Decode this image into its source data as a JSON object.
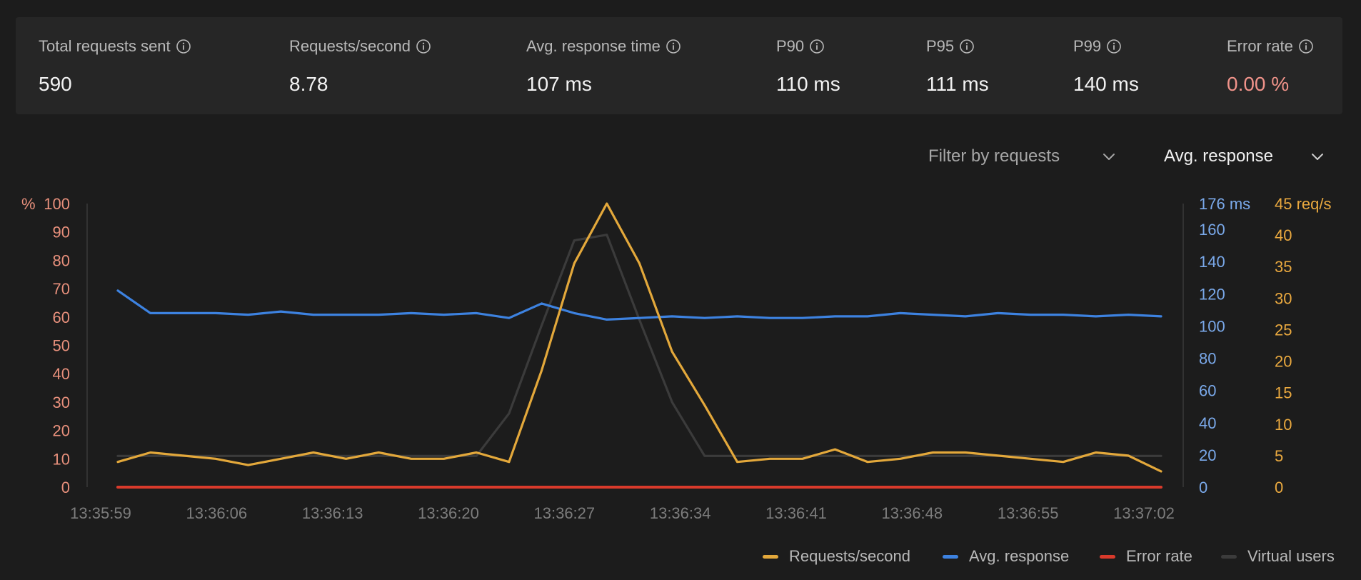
{
  "stats": [
    {
      "label": "Total requests sent",
      "value": "590"
    },
    {
      "label": "Requests/second",
      "value": "8.78"
    },
    {
      "label": "Avg. response time",
      "value": "107 ms"
    },
    {
      "label": "P90",
      "value": "110 ms"
    },
    {
      "label": "P95",
      "value": "111 ms"
    },
    {
      "label": "P99",
      "value": "140 ms"
    },
    {
      "label": "Error rate",
      "value": "0.00 %"
    }
  ],
  "controls": {
    "filter_label": "Filter by requests",
    "metric_label": "Avg. response"
  },
  "colors": {
    "requests": "#e3a83b",
    "avg_response": "#3d82e0",
    "error_rate": "#d93a2b",
    "virtual_users": "#3b3b3b",
    "left_axis": "#e8907c",
    "mid_axis": "#7aa9ea",
    "right_axis": "#eaa93f",
    "error_value": "#f0938a"
  },
  "chart_data": {
    "type": "line",
    "x": [
      "13:35:59",
      "13:36:01",
      "13:36:02",
      "13:36:04",
      "13:36:06",
      "13:36:08",
      "13:36:10",
      "13:36:12",
      "13:36:13",
      "13:36:15",
      "13:36:17",
      "13:36:19",
      "13:36:21",
      "13:36:22",
      "13:36:24",
      "13:36:26",
      "13:36:28",
      "13:36:30",
      "13:36:31",
      "13:36:33",
      "13:36:35",
      "13:36:37",
      "13:36:39",
      "13:36:40",
      "13:36:42",
      "13:36:44",
      "13:36:46",
      "13:36:48",
      "13:36:49",
      "13:36:51",
      "13:36:53",
      "13:36:55",
      "13:36:57",
      "13:36:58",
      "13:37:00",
      "13:37:02"
    ],
    "x_ticks": [
      "13:35:59",
      "13:36:06",
      "13:36:13",
      "13:36:20",
      "13:36:27",
      "13:36:34",
      "13:36:41",
      "13:36:48",
      "13:36:55",
      "13:37:02"
    ],
    "series": [
      {
        "name": "Requests/second",
        "axis": "right",
        "values": [
          4,
          5.5,
          5,
          4.5,
          3.5,
          4.5,
          5.5,
          4.5,
          5.5,
          4.5,
          4.5,
          5.5,
          4,
          18.5,
          35.5,
          45,
          35.5,
          21.5,
          13,
          4,
          4.5,
          4.5,
          6,
          4,
          4.5,
          5.5,
          5.5,
          5,
          4.5,
          4,
          5.5,
          5,
          2.5
        ]
      },
      {
        "name": "Avg. response",
        "axis": "mid",
        "values": [
          122,
          108,
          108,
          108,
          107,
          109,
          107,
          107,
          107,
          108,
          107,
          108,
          105,
          114,
          108,
          104,
          105,
          106,
          105,
          106,
          105,
          105,
          106,
          106,
          108,
          107,
          106,
          108,
          107,
          107,
          106,
          107,
          106
        ]
      },
      {
        "name": "Error rate",
        "axis": "left",
        "values": [
          0,
          0,
          0,
          0,
          0,
          0,
          0,
          0,
          0,
          0,
          0,
          0,
          0,
          0,
          0,
          0,
          0,
          0,
          0,
          0,
          0,
          0,
          0,
          0,
          0,
          0,
          0,
          0,
          0,
          0,
          0,
          0,
          0
        ]
      },
      {
        "name": "Virtual users",
        "axis": "left",
        "values": [
          11,
          11,
          11,
          11,
          11,
          11,
          11,
          11,
          11,
          11,
          11,
          11,
          26,
          57,
          87,
          89,
          59,
          30,
          11,
          11,
          11,
          11,
          11,
          11,
          11,
          11,
          11,
          11,
          11,
          11,
          11,
          11,
          11
        ]
      }
    ],
    "axes": {
      "left": {
        "unit": "%",
        "ticks": [
          0,
          10,
          20,
          30,
          40,
          50,
          60,
          70,
          80,
          90,
          100
        ],
        "range": [
          0,
          100
        ]
      },
      "mid": {
        "ticks": [
          "0",
          "20",
          "40",
          "60",
          "80",
          "100",
          "120",
          "140",
          "160",
          "176 ms"
        ],
        "range": [
          0,
          176
        ]
      },
      "right": {
        "ticks": [
          "0",
          "5",
          "10",
          "15",
          "20",
          "25",
          "30",
          "35",
          "40",
          "45 req/s"
        ],
        "range": [
          0,
          45
        ]
      }
    }
  }
}
